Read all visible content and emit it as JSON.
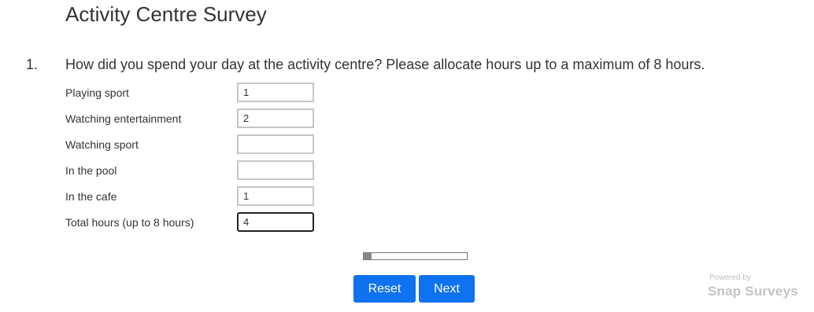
{
  "survey": {
    "title": "Activity Centre Survey"
  },
  "question": {
    "number": "1.",
    "text": "How did you spend your day at the activity centre? Please allocate hours up to a maximum of 8 hours.",
    "rows": [
      {
        "label": "Playing sport",
        "value": "1"
      },
      {
        "label": "Watching entertainment",
        "value": "2"
      },
      {
        "label": "Watching sport",
        "value": ""
      },
      {
        "label": "In the pool",
        "value": ""
      },
      {
        "label": "In the cafe",
        "value": "1"
      }
    ],
    "total": {
      "label": "Total hours (up to 8 hours)",
      "value": "4"
    }
  },
  "progress": {
    "fraction": 0.08
  },
  "buttons": {
    "reset_label": "Reset",
    "next_label": "Next"
  },
  "footer": {
    "powered_by": "Powered by",
    "brand": "Snap Surveys"
  },
  "colors": {
    "button": "#0f72f0",
    "text": "#333333",
    "progress_fill": "#888888"
  }
}
